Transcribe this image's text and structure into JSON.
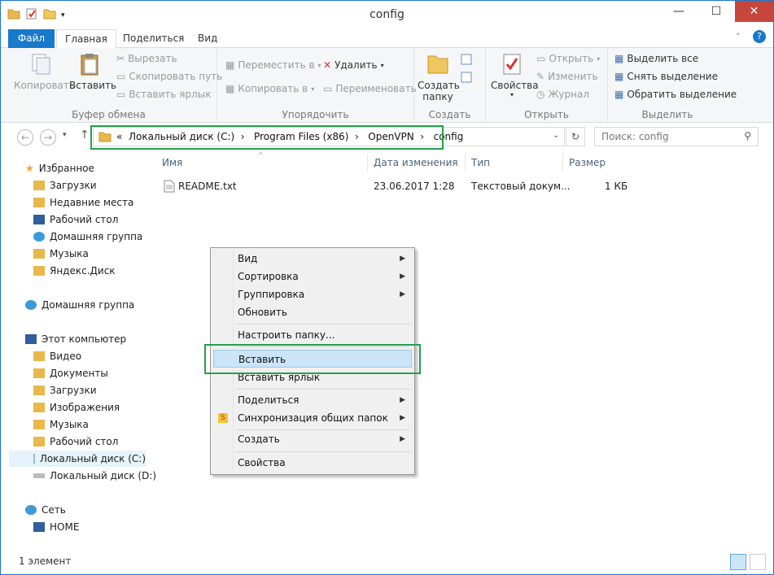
{
  "window": {
    "title": "config",
    "minimize": "—",
    "maximize": "☐",
    "close": "✕",
    "help": "?"
  },
  "ribbon_tabs": [
    "Файл",
    "Главная",
    "Поделиться",
    "Вид"
  ],
  "ribbon": {
    "clipboard": {
      "label": "Буфер обмена",
      "copy": "Копировать",
      "paste": "Вставить",
      "cut": "Вырезать",
      "copy_path": "Скопировать путь",
      "paste_shortcut": "Вставить ярлык"
    },
    "organize": {
      "label": "Упорядочить",
      "move_to": "Переместить в",
      "copy_to": "Копировать в",
      "delete": "Удалить",
      "rename": "Переименовать"
    },
    "create": {
      "label": "Создать",
      "new_folder_line1": "Создать",
      "new_folder_line2": "папку"
    },
    "open": {
      "label": "Открыть",
      "properties": "Свойства",
      "open": "Открыть",
      "edit": "Изменить",
      "history": "Журнал"
    },
    "select": {
      "label": "Выделить",
      "select_all": "Выделить все",
      "select_none": "Снять выделение",
      "invert": "Обратить выделение"
    }
  },
  "address": {
    "prefix": "«",
    "crumbs": [
      "Локальный диск (C:)",
      "Program Files (x86)",
      "OpenVPN",
      "config"
    ],
    "search_placeholder": "Поиск: config"
  },
  "nav": {
    "favorites": "Избранное",
    "fav_items": [
      "Загрузки",
      "Недавние места",
      "Рабочий стол",
      "Домашняя группа",
      "Музыка",
      "Яндекс.Диск"
    ],
    "homegroup": "Домашняя группа",
    "computer": "Этот компьютер",
    "comp_items": [
      "Видео",
      "Документы",
      "Загрузки",
      "Изображения",
      "Музыка",
      "Рабочий стол",
      "Локальный диск (C:)",
      "Локальный диск (D:)"
    ],
    "network": "Сеть",
    "net_items": [
      "HOME"
    ]
  },
  "columns": [
    "Имя",
    "Дата изменения",
    "Тип",
    "Размер"
  ],
  "files": [
    {
      "name": "README.txt",
      "date": "23.06.2017 1:28",
      "type": "Текстовый докум...",
      "size": "1 КБ"
    }
  ],
  "status": {
    "count": "1 элемент"
  },
  "context_menu": [
    "Вид",
    "Сортировка",
    "Группировка",
    "Обновить",
    "Настроить папку...",
    "Вставить",
    "Вставить ярлык",
    "Поделиться",
    "Синхронизация общих папок",
    "Создать",
    "Свойства"
  ],
  "colors": {
    "accent": "#1979ca",
    "highlight_green": "#22a24a",
    "close_red": "#c7463b"
  }
}
